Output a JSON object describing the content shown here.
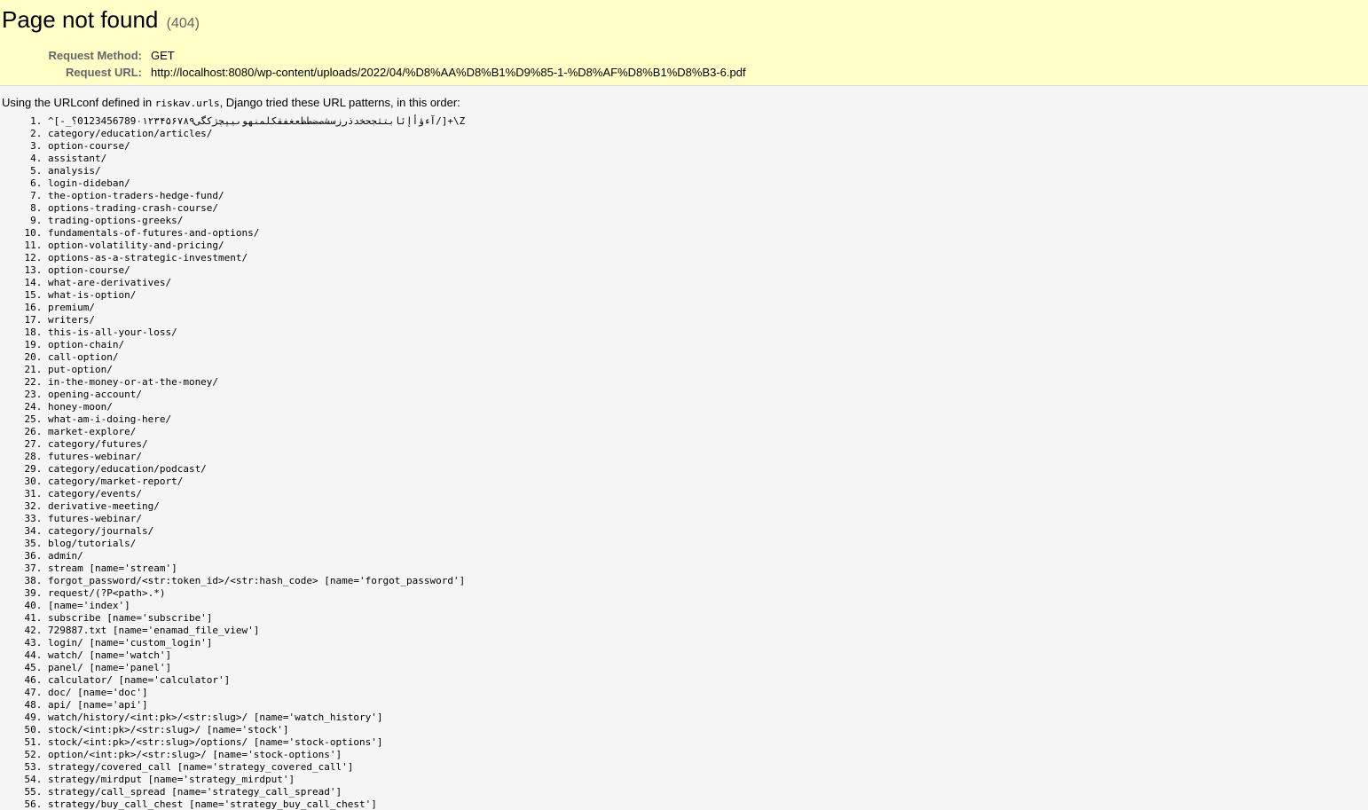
{
  "summary": {
    "title": "Page not found",
    "status": "(404)",
    "request_method_label": "Request Method:",
    "request_method": "GET",
    "request_url_label": "Request URL:",
    "request_url": "http://localhost:8080/wp-content/uploads/2022/04/%D8%AA%D8%B1%D9%85-1-%D8%AF%D8%B1%D8%B3-6.pdf"
  },
  "info": {
    "intro_prefix": "Using the URLconf defined in ",
    "urlconf": "riskav.urls",
    "intro_suffix": ", Django tried these URL patterns, in this order:",
    "patterns": [
      "^[-_آءؤأإئابتثجحخدذرزسشصضطظعغفقكلمنهوىيپچژکگی0123456789۰۱۲۳۴۵۶۷۸۹؟/]+\\Z",
      "category/education/articles/",
      "option-course/",
      "assistant/",
      "analysis/",
      "login-dideban/",
      "the-option-traders-hedge-fund/",
      "options-trading-crash-course/",
      "trading-options-greeks/",
      "fundamentals-of-futures-and-options/",
      "option-volatility-and-pricing/",
      "options-as-a-strategic-investment/",
      "option-course/",
      "what-are-derivatives/",
      "what-is-option/",
      "premium/",
      "writers/",
      "this-is-all-your-loss/",
      "option-chain/",
      "call-option/",
      "put-option/",
      "in-the-money-or-at-the-money/",
      "opening-account/",
      "honey-moon/",
      "what-am-i-doing-here/",
      "market-explore/",
      "category/futures/",
      "futures-webinar/",
      "category/education/podcast/",
      "category/market-report/",
      "category/events/",
      "derivative-meeting/",
      "futures-webinar/",
      "category/journals/",
      "blog/tutorials/",
      "admin/",
      "stream [name='stream']",
      "forgot_password/<str:token_id>/<str:hash_code> [name='forgot_password']",
      "request/(?P<path>.*)",
      "[name='index']",
      "subscribe [name='subscribe']",
      "729887.txt [name='enamad_file_view']",
      "login/ [name='custom_login']",
      "watch/ [name='watch']",
      "panel/ [name='panel']",
      "calculator/ [name='calculator']",
      "doc/ [name='doc']",
      "api/ [name='api']",
      "watch/history/<int:pk>/<str:slug>/ [name='watch_history']",
      "stock/<int:pk>/<str:slug>/ [name='stock']",
      "stock/<int:pk>/<str:slug>/options/ [name='stock-options']",
      "option/<int:pk>/<str:slug>/ [name='stock-options']",
      "strategy/covered_call [name='strategy_covered_call']",
      "strategy/mirdput [name='strategy_mirdput']",
      "strategy/call_spread [name='strategy_call_spread']",
      "strategy/buy_call_chest [name='strategy_buy_call_chest']"
    ]
  }
}
